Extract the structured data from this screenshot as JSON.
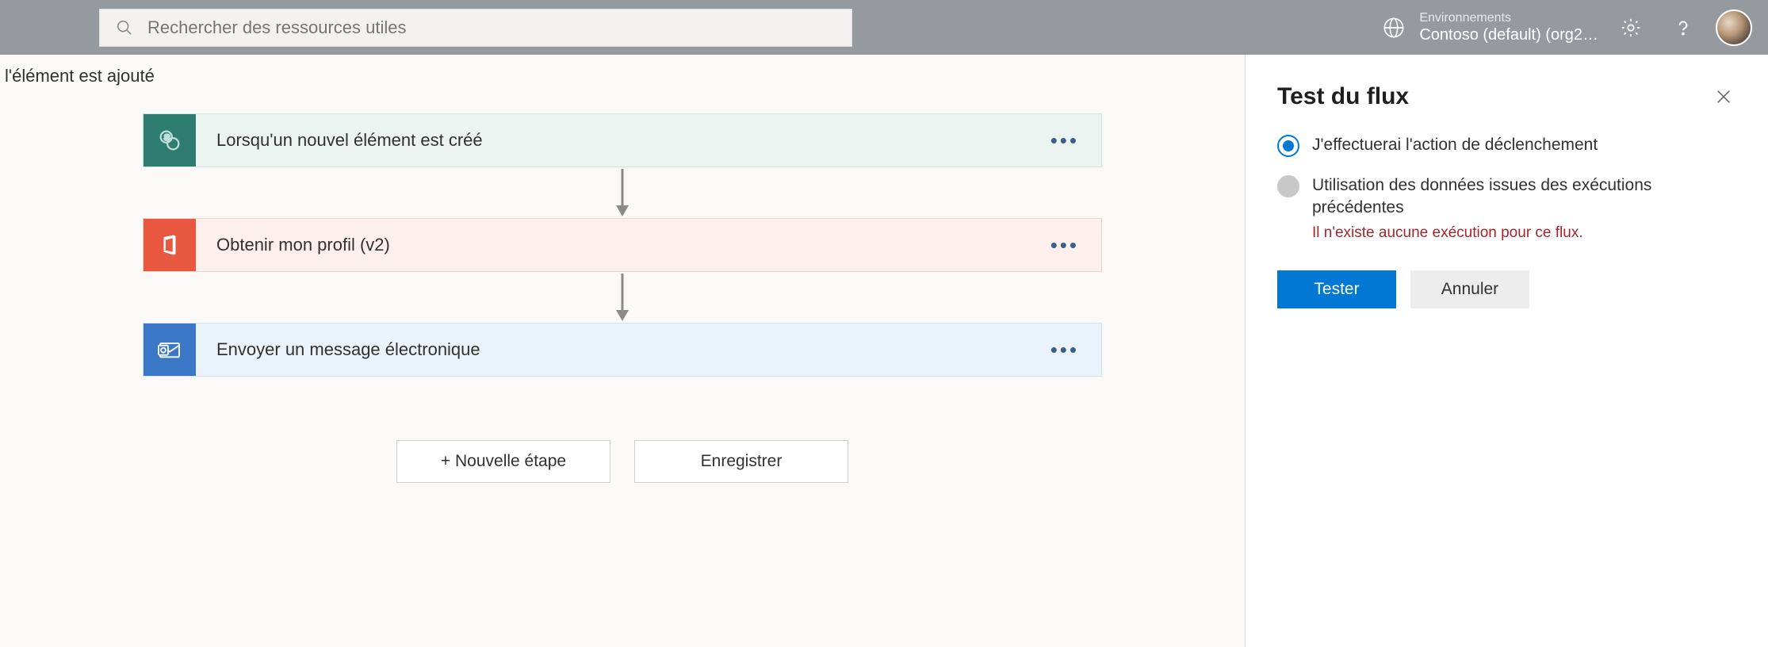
{
  "header": {
    "search_placeholder": "Rechercher des ressources utiles",
    "env_label": "Environnements",
    "env_value": "Contoso (default) (org2…"
  },
  "breadcrumb": "l'élément est ajouté",
  "flow": {
    "steps": [
      {
        "label": "Lorsqu'un nouvel élément est créé",
        "icon": "sharepoint-icon",
        "color": "green"
      },
      {
        "label": "Obtenir mon profil (v2)",
        "icon": "office-icon",
        "color": "red"
      },
      {
        "label": "Envoyer un message électronique",
        "icon": "outlook-icon",
        "color": "blue"
      }
    ],
    "new_step_label": "+ Nouvelle étape",
    "save_label": "Enregistrer"
  },
  "panel": {
    "title": "Test du flux",
    "options": [
      {
        "label": "J'effectuerai l'action de déclenchement",
        "selected": true,
        "enabled": true
      },
      {
        "label": "Utilisation des données issues des exécutions précédentes",
        "selected": false,
        "enabled": false,
        "error": "Il n'existe aucune exécution pour ce flux."
      }
    ],
    "test_label": "Tester",
    "cancel_label": "Annuler"
  }
}
